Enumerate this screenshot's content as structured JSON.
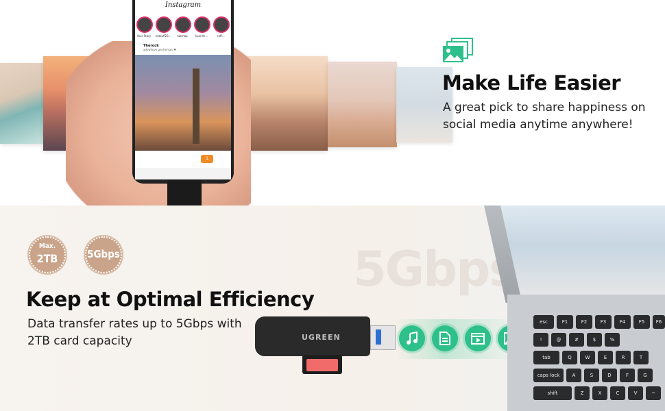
{
  "top_section": {
    "title": "Make Life Easier",
    "description": "A great pick to share happiness on social media anytime anywhere!",
    "icon": "image-gallery-icon",
    "phone": {
      "app_title": "Instagram",
      "stories": [
        "Your Story",
        "notaufl23...",
        "natmap",
        "kuenlin...",
        "coff..."
      ],
      "post_user": "Therock",
      "post_sub": "@kiwilove gentleman ♥",
      "notification_count": "1"
    }
  },
  "bottom_section": {
    "title": "Keep at Optimal Efficiency",
    "description": "Data transfer rates up to 5Gbps with 2TB card capacity",
    "watermark": "5Gbps",
    "badges": [
      {
        "line1": "Max.",
        "line2": "2TB"
      },
      {
        "line1": "",
        "line2": "5Gbps"
      }
    ],
    "device_brand": "UGREEN",
    "file_icons": [
      "music-file-icon",
      "document-file-icon",
      "video-file-icon",
      "image-file-icon"
    ],
    "accent_color": "#2ec08a",
    "keyboard_keys": [
      "esc",
      "F1",
      "F2",
      "F3",
      "F4",
      "F5",
      "F6",
      "tab",
      "Q",
      "W",
      "E",
      "R",
      "T",
      "caps lock",
      "A",
      "S",
      "D",
      "F",
      "G",
      "shift",
      "Z",
      "X",
      "C",
      "V",
      "~",
      "!",
      "@",
      "#",
      "$",
      "%"
    ]
  }
}
